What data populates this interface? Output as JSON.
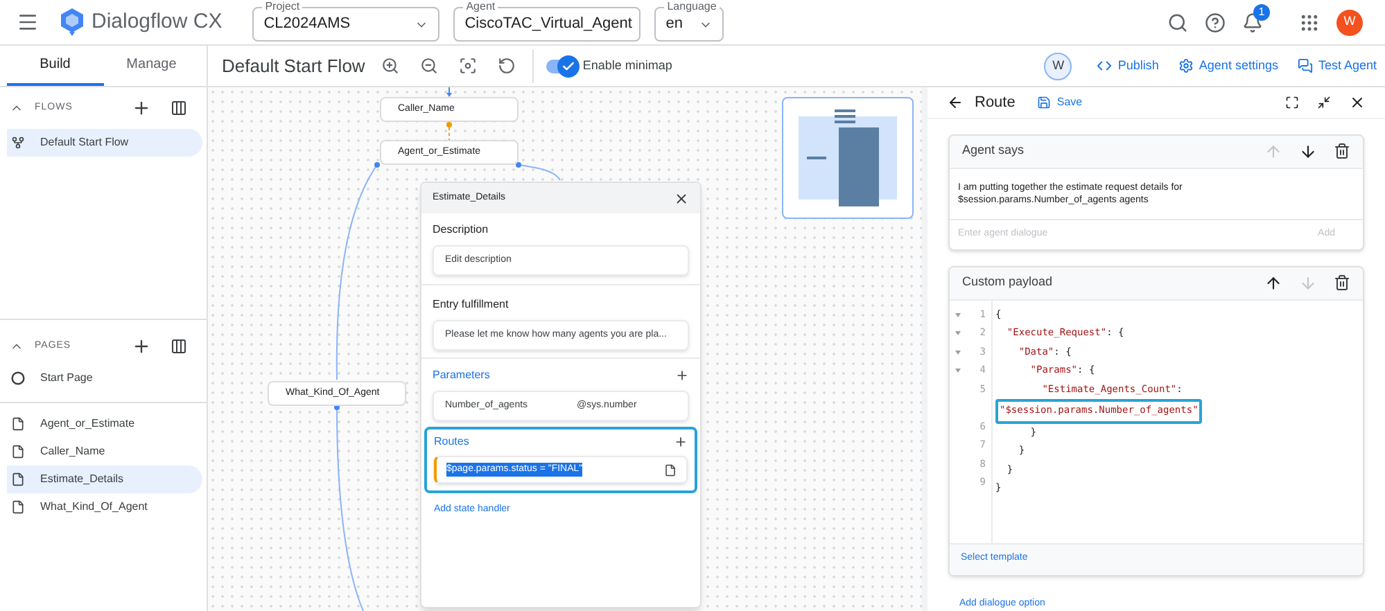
{
  "header": {
    "app_name": "Dialogflow CX",
    "selects": [
      {
        "label": "Project",
        "value": "CL2024AMS"
      },
      {
        "label": "Agent",
        "value": "CiscoTAC_Virtual_Agent"
      },
      {
        "label": "Language",
        "value": "en"
      }
    ],
    "notification_count": "1",
    "avatar_letter": "W"
  },
  "nav_tabs": [
    {
      "label": "Build",
      "selected": true
    },
    {
      "label": "Manage",
      "selected": false
    }
  ],
  "toolbar": {
    "flow_title": "Default Start Flow",
    "minimap_toggle": {
      "label": "Enable minimap",
      "on": true
    },
    "user_letter": "W",
    "actions": [
      {
        "kind": "code",
        "label": "Publish"
      },
      {
        "kind": "settings",
        "label": "Agent settings"
      },
      {
        "kind": "chat",
        "label": "Test Agent"
      }
    ]
  },
  "sidebar": {
    "flows": {
      "title": "FLOWS",
      "items": [
        {
          "label": "Default Start Flow",
          "selected": true
        }
      ]
    },
    "pages": {
      "title": "PAGES",
      "items": [
        {
          "kind": "start",
          "label": "Start Page",
          "selected": false
        },
        {
          "kind": "page",
          "label": "Agent_or_Estimate",
          "selected": false
        },
        {
          "kind": "page",
          "label": "Caller_Name",
          "selected": false
        },
        {
          "kind": "page",
          "label": "Estimate_Details",
          "selected": true
        },
        {
          "kind": "page",
          "label": "What_Kind_Of_Agent",
          "selected": false
        }
      ]
    }
  },
  "canvas": {
    "nodes": [
      {
        "label": "Caller_Name"
      },
      {
        "label": "Agent_or_Estimate"
      },
      {
        "label": "What_Kind_Of_Agent"
      }
    ],
    "page_panel": {
      "title": "Estimate_Details",
      "description": {
        "heading": "Description",
        "value": "Edit description"
      },
      "entry_fulfillment": {
        "heading": "Entry fulfillment",
        "value": "Please let me know how many agents you are pla..."
      },
      "parameters": {
        "heading": "Parameters",
        "items": [
          {
            "name": "Number_of_agents",
            "type": "@sys.number"
          }
        ]
      },
      "routes": {
        "heading": "Routes",
        "highlighted": true,
        "items": [
          {
            "condition": "$page.params.status = \"FINAL\"",
            "selected": true
          }
        ]
      },
      "add_state_handler": "Add state handler"
    }
  },
  "route_panel": {
    "title": "Route",
    "save": "Save",
    "cards": [
      {
        "kind": "text",
        "title": "Agent says",
        "up_enabled": false,
        "down_enabled": true,
        "text": "I am putting together the estimate request details for $session.params.Number_of_agents agents",
        "placeholder": "Enter agent dialogue",
        "add": "Add"
      },
      {
        "kind": "payload",
        "title": "Custom payload",
        "up_enabled": true,
        "down_enabled": false,
        "lines": [
          {
            "number": "1",
            "foldable": true,
            "tokens": [
              {
                "kind": "punct",
                "text": "{"
              }
            ]
          },
          {
            "number": "2",
            "foldable": true,
            "tokens": [
              {
                "kind": "string",
                "text": "  \"Execute_Request\""
              },
              {
                "kind": "punct",
                "text": ": {"
              }
            ]
          },
          {
            "number": "3",
            "foldable": true,
            "tokens": [
              {
                "kind": "string",
                "text": "    \"Data\""
              },
              {
                "kind": "punct",
                "text": ": {"
              }
            ]
          },
          {
            "number": "4",
            "foldable": true,
            "tokens": [
              {
                "kind": "string",
                "text": "      \"Params\""
              },
              {
                "kind": "punct",
                "text": ": {"
              }
            ]
          },
          {
            "number": "5",
            "foldable": false,
            "tokens": [
              {
                "kind": "string",
                "text": "        \"Estimate_Agents_Count\""
              },
              {
                "kind": "punct",
                "text": ":"
              }
            ],
            "continuation": "\"$session.params.Number_of_agents\"",
            "highlighted": true
          },
          {
            "number": "6",
            "foldable": false,
            "tokens": [
              {
                "kind": "punct",
                "text": "      }"
              }
            ]
          },
          {
            "number": "7",
            "foldable": false,
            "tokens": [
              {
                "kind": "punct",
                "text": "    }"
              }
            ]
          },
          {
            "number": "8",
            "foldable": false,
            "tokens": [
              {
                "kind": "punct",
                "text": "  }"
              }
            ]
          },
          {
            "number": "9",
            "foldable": false,
            "tokens": [
              {
                "kind": "punct",
                "text": "}"
              }
            ]
          }
        ],
        "footer": "Select template"
      }
    ],
    "add_option": "Add dialogue option"
  }
}
